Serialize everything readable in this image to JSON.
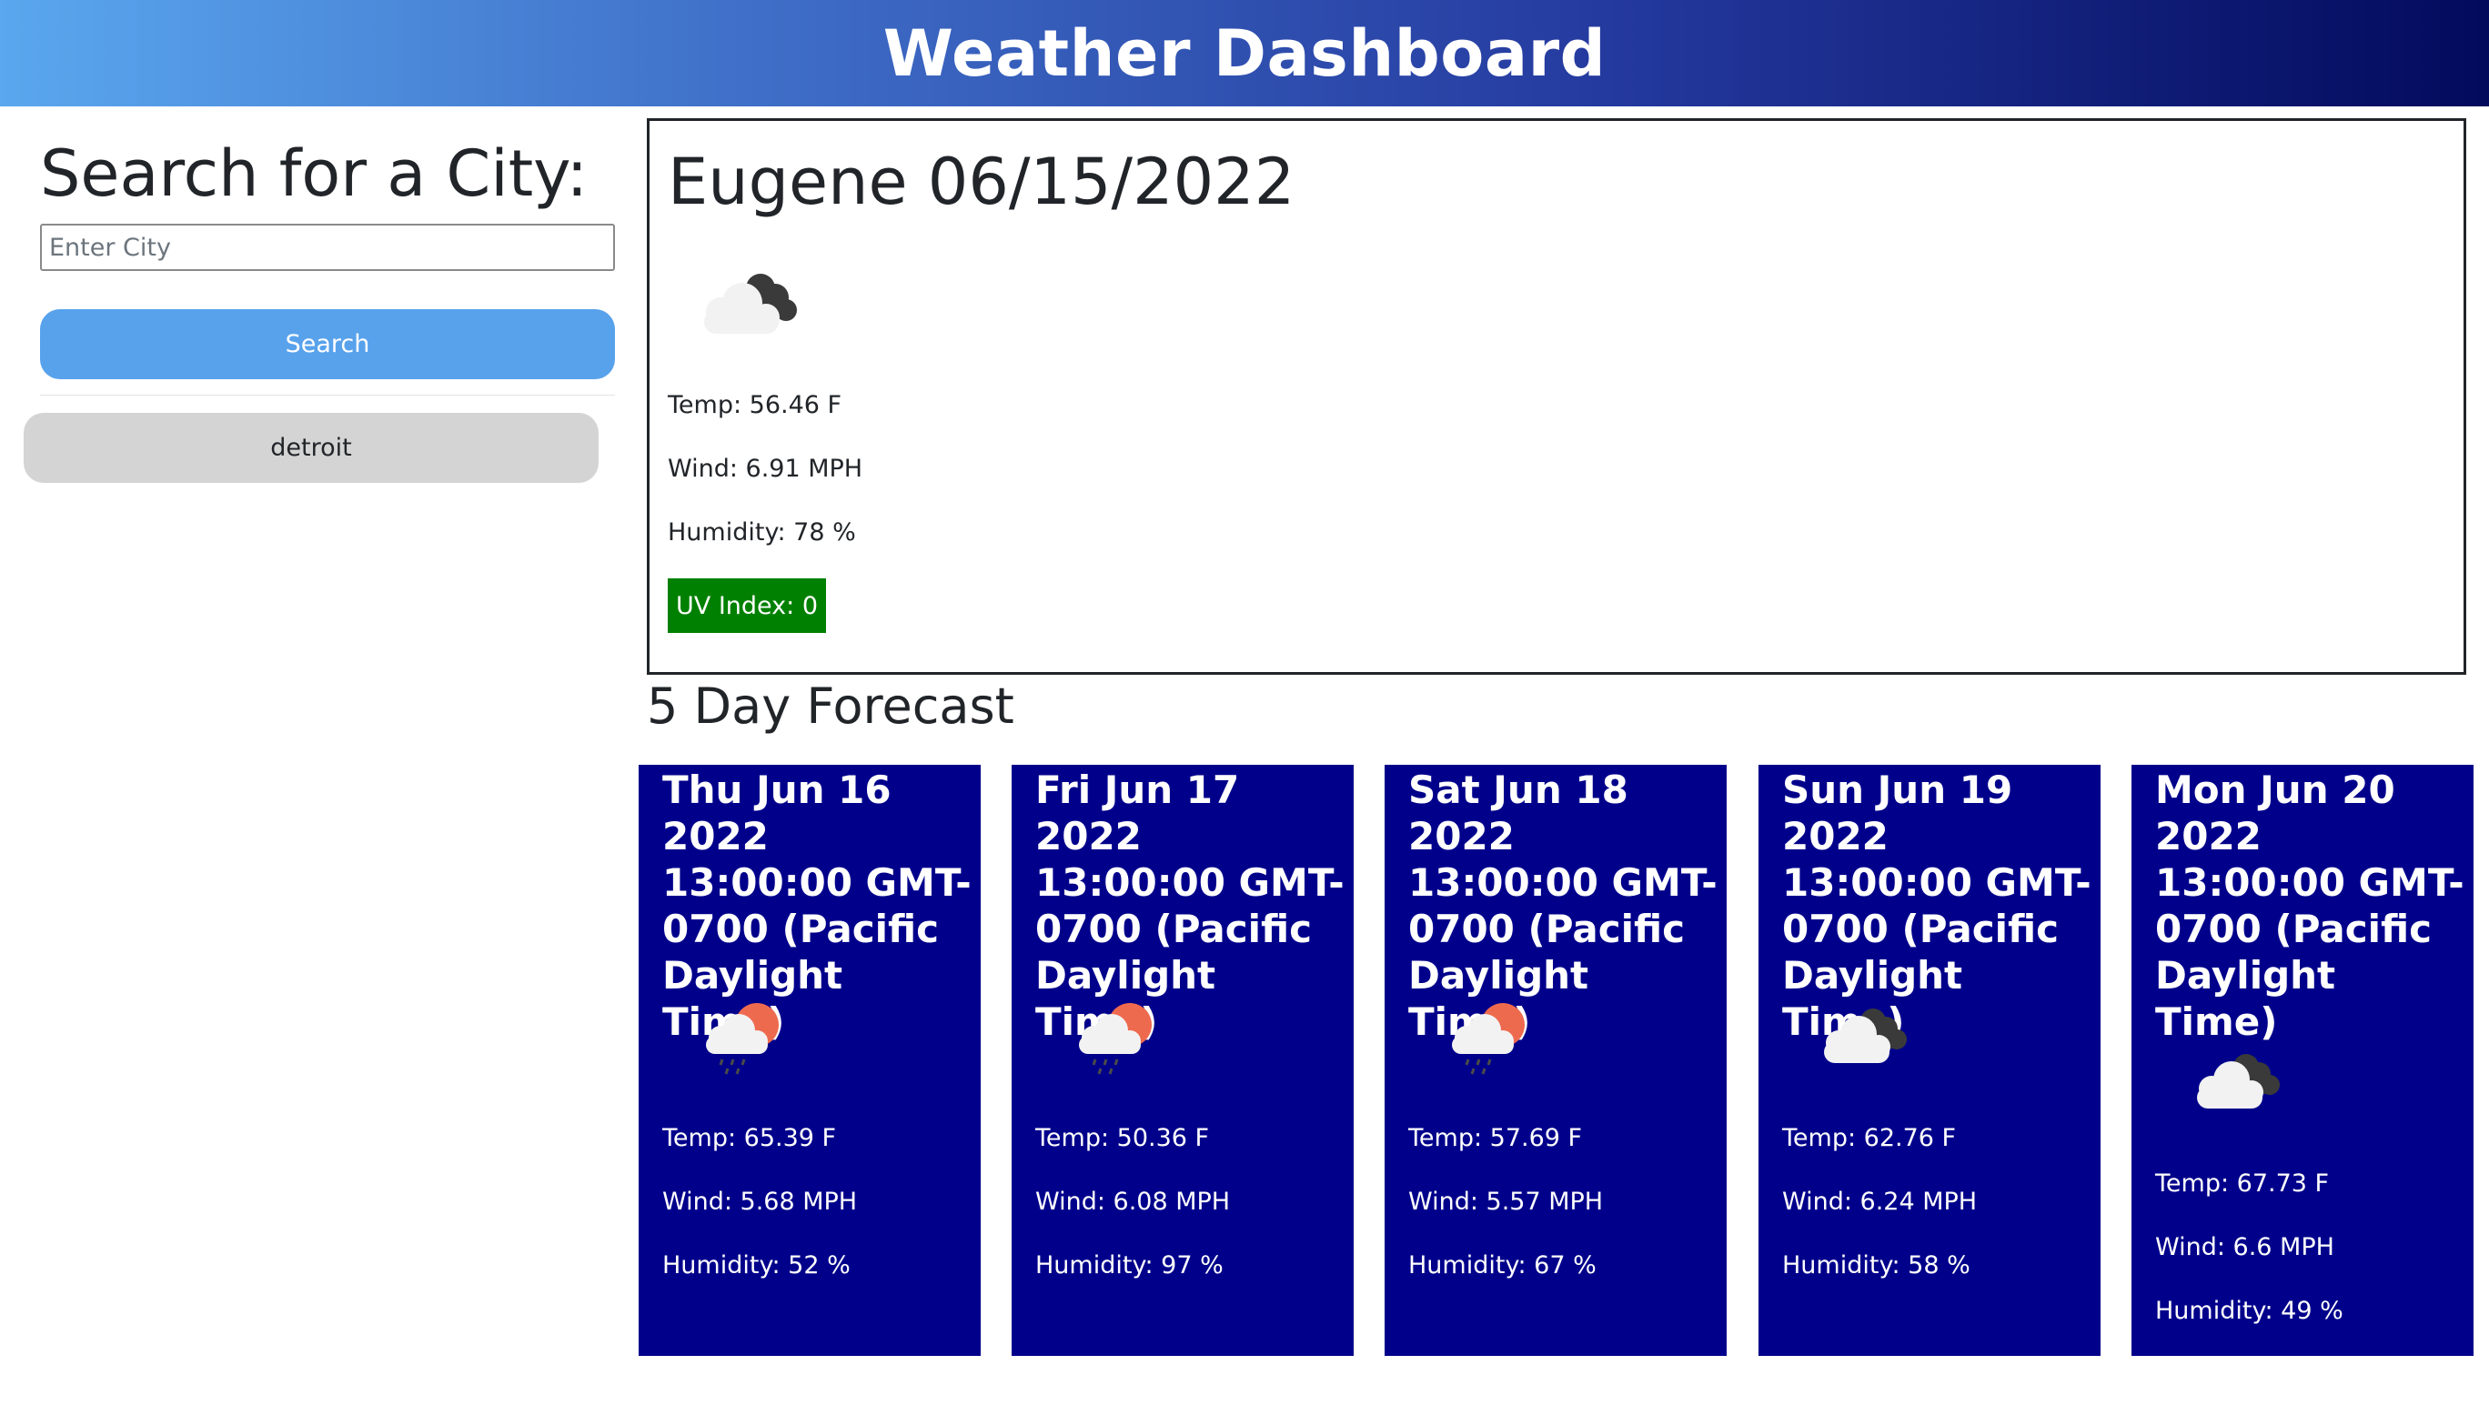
{
  "header": {
    "title": "Weather Dashboard"
  },
  "sidebar": {
    "heading": "Search for a City:",
    "input_placeholder": "Enter City",
    "input_value": "",
    "search_label": "Search",
    "history": [
      "detroit"
    ]
  },
  "current": {
    "title": "Eugene 06/15/2022",
    "icon": "broken-clouds-icon",
    "temp": "Temp: 56.46 F",
    "wind": "Wind: 6.91 MPH",
    "humidity": "Humidity: 78 %",
    "uv": "UV Index: 0",
    "uv_color": "#008000"
  },
  "forecast": {
    "heading": "5 Day Forecast",
    "card_color": "#00008b",
    "days": [
      {
        "date": "Thu Jun 16 2022 13:00:00 GMT-0700 (Pacific Daylight Time)",
        "icon": "rain-sun-icon",
        "temp": "Temp: 65.39 F",
        "wind": "Wind: 5.68 MPH",
        "humidity": "Humidity: 52 %"
      },
      {
        "date": "Fri Jun 17 2022 13:00:00 GMT-0700 (Pacific Daylight Time)",
        "icon": "rain-sun-icon",
        "temp": "Temp: 50.36 F",
        "wind": "Wind: 6.08 MPH",
        "humidity": "Humidity: 97 %"
      },
      {
        "date": "Sat Jun 18 2022 13:00:00 GMT-0700 (Pacific Daylight Time)",
        "icon": "rain-sun-icon",
        "temp": "Temp: 57.69 F",
        "wind": "Wind: 5.57 MPH",
        "humidity": "Humidity: 67 %"
      },
      {
        "date": "Sun Jun 19 2022 13:00:00 GMT-0700 (Pacific Daylight Time)",
        "icon": "broken-clouds-icon",
        "temp": "Temp: 62.76 F",
        "wind": "Wind: 6.24 MPH",
        "humidity": "Humidity: 58 %"
      },
      {
        "date": "Mon Jun 20 2022 13:00:00 GMT-0700 (Pacific Daylight Time)",
        "icon": "broken-clouds-icon",
        "temp": "Temp: 67.73 F",
        "wind": "Wind: 6.6 MPH",
        "humidity": "Humidity: 49 %"
      }
    ]
  }
}
